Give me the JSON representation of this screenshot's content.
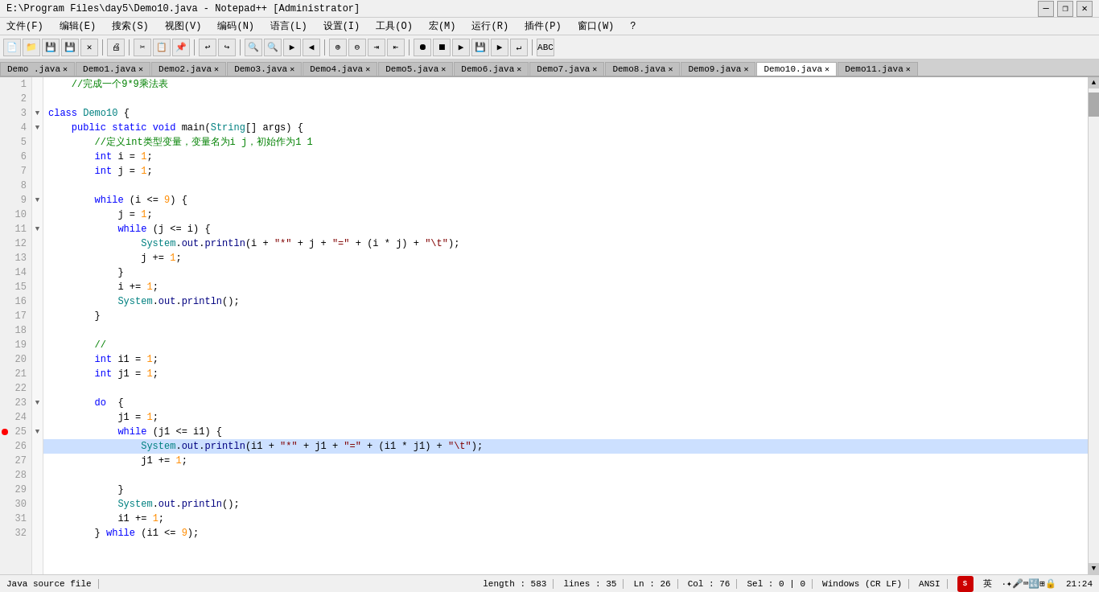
{
  "titlebar": {
    "title": "E:\\Program Files\\day5\\Demo10.java - Notepad++ [Administrator]",
    "min_label": "—",
    "max_label": "❐",
    "close_label": "✕",
    "extra_close": "✕"
  },
  "menubar": {
    "items": [
      "文件(F)",
      "编辑(E)",
      "搜索(S)",
      "视图(V)",
      "编码(N)",
      "语言(L)",
      "设置(I)",
      "工具(O)",
      "宏(M)",
      "运行(R)",
      "插件(P)",
      "窗口(W)",
      "?"
    ]
  },
  "tabs": [
    {
      "label": "Demo.java",
      "active": false
    },
    {
      "label": "Demo1.java",
      "active": false
    },
    {
      "label": "Demo2.java",
      "active": false
    },
    {
      "label": "Demo3.java",
      "active": false
    },
    {
      "label": "Demo4.java",
      "active": false
    },
    {
      "label": "Demo5.java",
      "active": false
    },
    {
      "label": "Demo6.java",
      "active": false
    },
    {
      "label": "Demo7.java",
      "active": false
    },
    {
      "label": "Demo8.java",
      "active": false
    },
    {
      "label": "Demo9.java",
      "active": false
    },
    {
      "label": "Demo10.java",
      "active": true
    },
    {
      "label": "Demo11.java",
      "active": false
    }
  ],
  "statusbar": {
    "file_type": "Java source file",
    "length": "length : 583",
    "lines": "lines : 35",
    "ln": "Ln : 26",
    "col": "Col : 76",
    "sel": "Sel : 0 | 0",
    "encoding": "Windows (CR LF)",
    "charset": "ANSI",
    "time": "21:24"
  }
}
